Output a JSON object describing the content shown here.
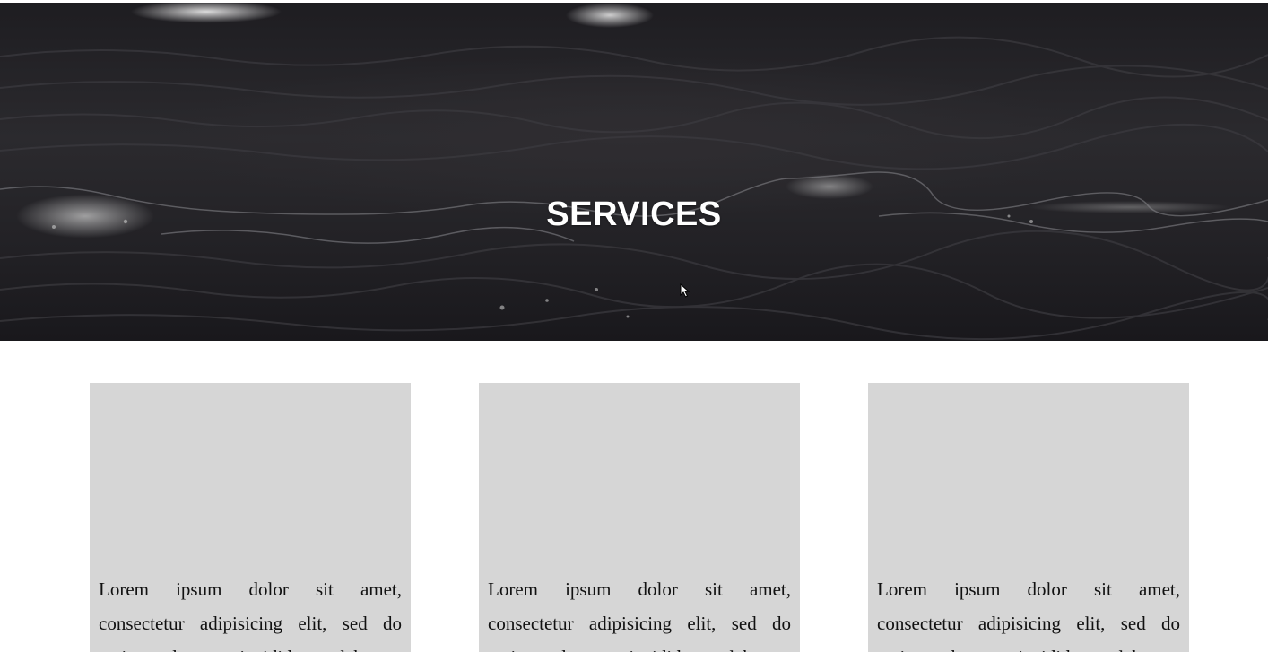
{
  "hero": {
    "title": "SERVICES"
  },
  "cards": [
    {
      "text": "Lorem ipsum dolor sit amet, consectetur adipisicing elit, sed do eiusmod tempor incididunt ut labore"
    },
    {
      "text": "Lorem ipsum dolor sit amet, consectetur adipisicing elit, sed do eiusmod tempor incididunt ut labore"
    },
    {
      "text": "Lorem ipsum dolor sit amet, consectetur adipisicing elit, sed do eiusmod tempor incididunt ut labore"
    }
  ],
  "colors": {
    "hero_overlay": "#222125",
    "card_background": "#d6d6d6",
    "title_text": "#ffffff"
  },
  "icons": {
    "cursor": "mouse-pointer-icon"
  }
}
